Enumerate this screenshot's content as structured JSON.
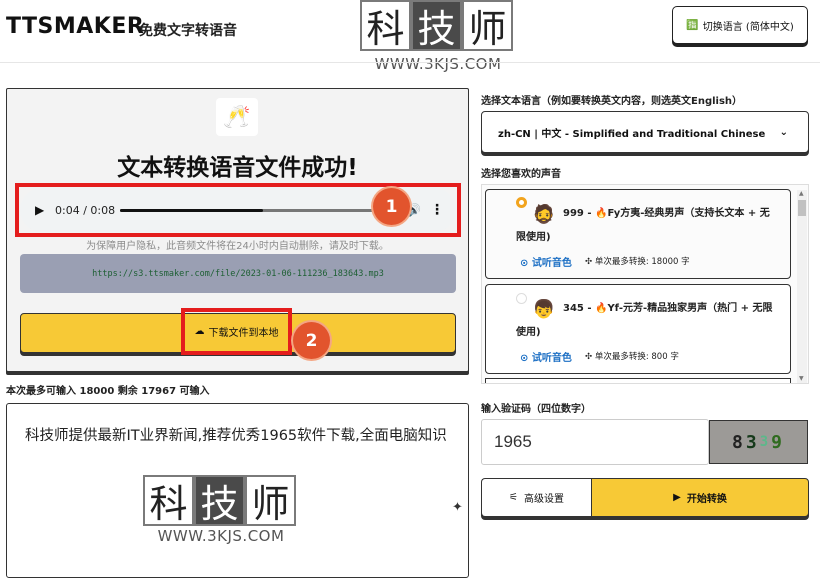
{
  "header": {
    "logo": "TTSMAKER",
    "tagline": "免费文字转语音",
    "watermark_chars": [
      "科",
      "技",
      "师"
    ],
    "watermark_url": "WWW.3KJS.COM",
    "switch_language": "切换语言 (简体中文)"
  },
  "result": {
    "title": "文本转换语音文件成功!",
    "audio": {
      "time": "0:04 / 0:08",
      "progress_fraction": 0.5
    },
    "privacy_note": "为保障用户隐私，此音频文件将在24小时内自动删除，请及时下载。",
    "file_url": "https://s3.ttsmaker.com/file/2023-01-06-111236_183643.mp3",
    "download_label": "下载文件到本地",
    "badges": [
      "1",
      "2"
    ]
  },
  "input": {
    "counter": "本次最多可输入 18000 剩余 17967 可输入",
    "text": "科技师提供最新IT业界新闻,推荐优秀1965软件下载,全面电脑知识"
  },
  "language": {
    "label": "选择文本语言（例如要转换英文内容，则选英文English）",
    "selected": "zh-CN | 中文 - Simplified and Traditional Chinese"
  },
  "voices": {
    "label": "选择您喜欢的声音",
    "items": [
      {
        "name": "999 - 🔥Fy方夷-经典男声（支持长文本 + 无限使用)",
        "listen": "试听音色",
        "max": "单次最多转换: 18000 字",
        "selected": true
      },
      {
        "name": "345 - 🔥Yf-元芳-精品独家男声（热门 + 无限使用)",
        "listen": "试听音色",
        "max": "单次最多转换: 800 字",
        "selected": false
      }
    ]
  },
  "captcha": {
    "label": "输入验证码（四位数字）",
    "value": "1965",
    "image_text": [
      "8",
      "3",
      "3",
      "9"
    ]
  },
  "actions": {
    "advanced": "高级设置",
    "convert": "开始转换"
  }
}
